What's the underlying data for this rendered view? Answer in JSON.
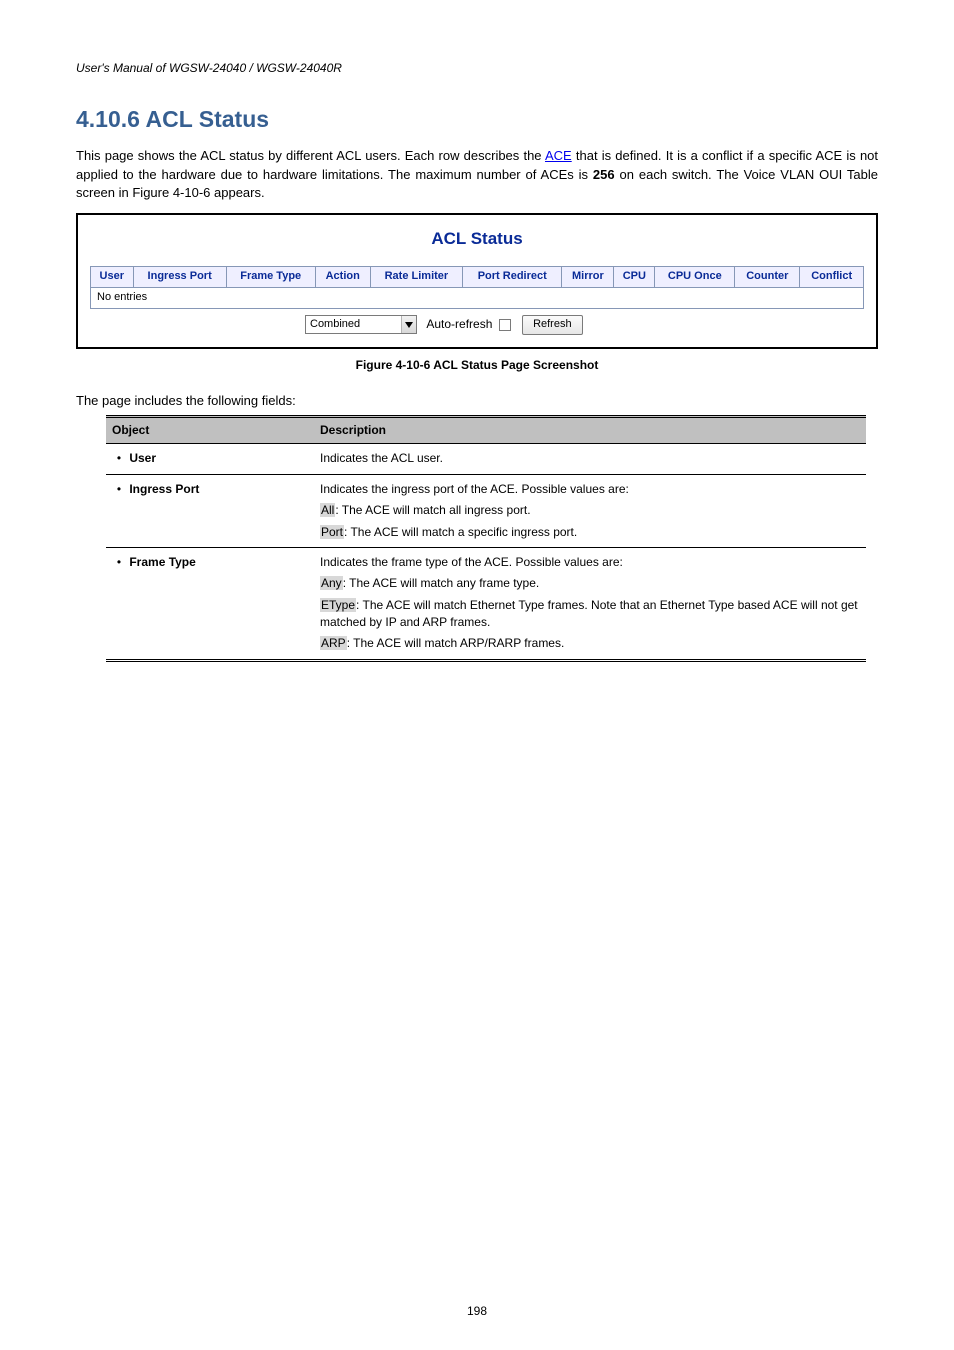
{
  "manual_name": "User's Manual of WGSW-24040 / WGSW-24040R",
  "section": {
    "number": "4.10.6",
    "title": "ACL Status"
  },
  "intro": {
    "p1": "This page shows the ACL status by different ACL users. Each row describes the ACE that is defined. It is a conflict if a specific ACE is not applied to the hardware due to hardware limitations. The maximum number of ACEs is 256 on each switch. The Voice VLAN OUI Table screen in Figure 4-10-6 appears.",
    "oui_ref": "ACE"
  },
  "acl_panel": {
    "title": "ACL Status",
    "headers": [
      "User",
      "Ingress Port",
      "Frame Type",
      "Action",
      "Rate Limiter",
      "Port Redirect",
      "Mirror",
      "CPU",
      "CPU Once",
      "Counter",
      "Conflict"
    ],
    "no_entries": "No entries",
    "combined_selected": "Combined",
    "auto_refresh_label": "Auto-refresh",
    "refresh_label": "Refresh"
  },
  "figure_caption": "Figure 4-10-6 ACL Status Page Screenshot",
  "lead_in": "The page includes the following fields:",
  "def_table": {
    "header": {
      "object": "Object",
      "description": "Description"
    },
    "rows": [
      {
        "object": "User",
        "desc_plain": "Indicates the ACL user."
      },
      {
        "object": "Ingress Port",
        "desc_intro": "Indicates the ingress port of the ACE. Possible values are:",
        "items": [
          {
            "hl": "All",
            "rest": ": The ACE will match all ingress port."
          },
          {
            "hl": "Port",
            "rest": ": The ACE will match a specific ingress port."
          }
        ]
      },
      {
        "object": "Frame Type",
        "desc_intro": "Indicates the frame type of the ACE. Possible values are:",
        "items": [
          {
            "hl": "Any",
            "rest": ": The ACE will match any frame type."
          },
          {
            "hl": "EType",
            "rest": ": The ACE will match Ethernet Type frames. Note that an Ethernet Type based ACE will not get matched by IP and ARP frames."
          },
          {
            "hl": "ARP",
            "rest": ": The ACE will match ARP/RARP frames."
          }
        ]
      }
    ]
  },
  "page_number": "198"
}
